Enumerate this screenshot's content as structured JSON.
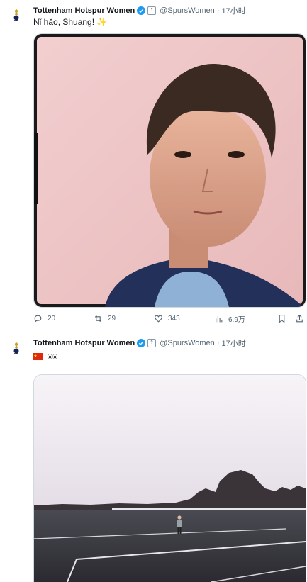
{
  "tweets": [
    {
      "author": "Tottenham Hotspur Women",
      "handle": "@SpursWomen",
      "separator": "·",
      "time": "17小时",
      "text": "Nǐ hǎo, Shuang! ✨",
      "stats": {
        "replies": "20",
        "retweets": "29",
        "likes": "343",
        "views": "6.9万"
      }
    },
    {
      "author": "Tottenham Hotspur Women",
      "handle": "@SpursWomen",
      "separator": "·",
      "time": "17小时"
    }
  ],
  "colors": {
    "text": "#0f1419",
    "secondary": "#536471",
    "verified": "#1d9bf0",
    "border": "#cfd9de"
  },
  "icons": [
    "spurs-logo-icon",
    "verified-icon",
    "affiliate-badge-icon",
    "reply-icon",
    "retweet-icon",
    "like-icon",
    "views-icon",
    "bookmark-icon",
    "share-icon",
    "china-flag-icon",
    "eyes-emoji-icon"
  ]
}
